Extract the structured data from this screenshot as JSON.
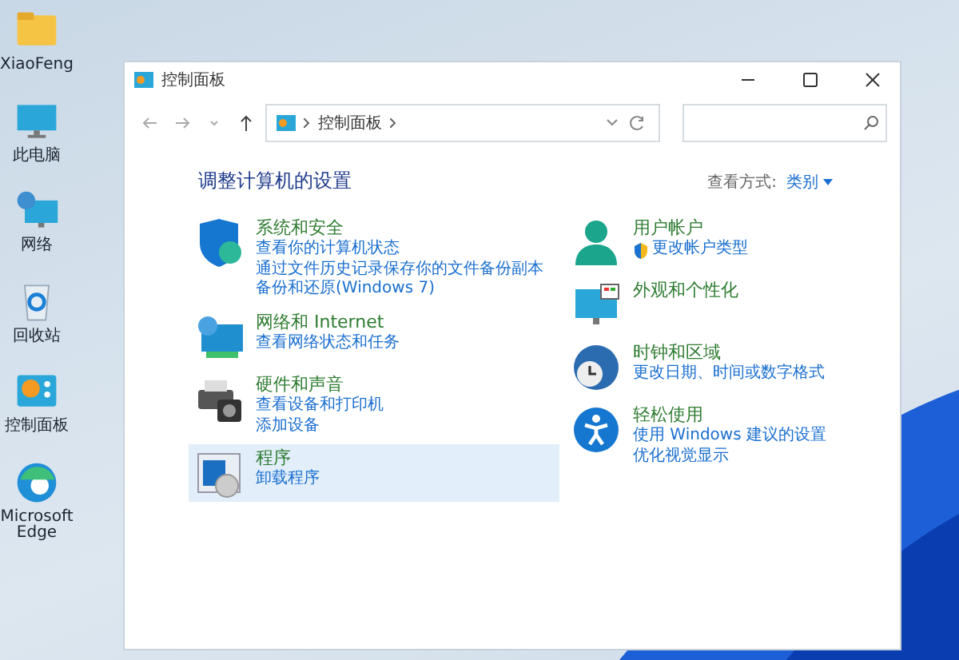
{
  "desktop_icons": [
    {
      "label": "XiaoFeng",
      "kind": "folder"
    },
    {
      "label": "此电脑",
      "kind": "computer"
    },
    {
      "label": "网络",
      "kind": "network"
    },
    {
      "label": "回收站",
      "kind": "recycle"
    },
    {
      "label": "控制面板",
      "kind": "control"
    },
    {
      "label": "Microsoft Edge",
      "kind": "edge"
    }
  ],
  "window": {
    "title": "控制面板"
  },
  "address_bar": {
    "path": "控制面板"
  },
  "heading": "调整计算机的设置",
  "view_by": {
    "label": "查看方式:",
    "value": "类别"
  },
  "left_categories": [
    {
      "kind": "security",
      "title": "系统和安全",
      "selected": false,
      "link_shield": false,
      "links": [
        "查看你的计算机状态",
        "通过文件历史记录保存你的文件备份副本",
        "备份和还原(Windows 7)"
      ]
    },
    {
      "kind": "network",
      "title": "网络和 Internet",
      "selected": false,
      "link_shield": false,
      "links": [
        "查看网络状态和任务"
      ]
    },
    {
      "kind": "hardware",
      "title": "硬件和声音",
      "selected": false,
      "link_shield": false,
      "links": [
        "查看设备和打印机",
        "添加设备"
      ]
    },
    {
      "kind": "programs",
      "title": "程序",
      "selected": true,
      "link_shield": false,
      "links": [
        "卸载程序"
      ]
    }
  ],
  "right_categories": [
    {
      "kind": "user",
      "title": "用户帐户",
      "selected": false,
      "link_shield": true,
      "links": [
        "更改帐户类型"
      ]
    },
    {
      "kind": "appearance",
      "title": "外观和个性化",
      "selected": false
    },
    {
      "kind": "clock",
      "title": "时钟和区域",
      "selected": false,
      "link_shield": false,
      "links": [
        "更改日期、时间或数字格式"
      ]
    },
    {
      "kind": "access",
      "title": "轻松使用",
      "selected": false,
      "link_shield": false,
      "links": [
        "使用 Windows 建议的设置",
        "优化视觉显示"
      ]
    }
  ]
}
